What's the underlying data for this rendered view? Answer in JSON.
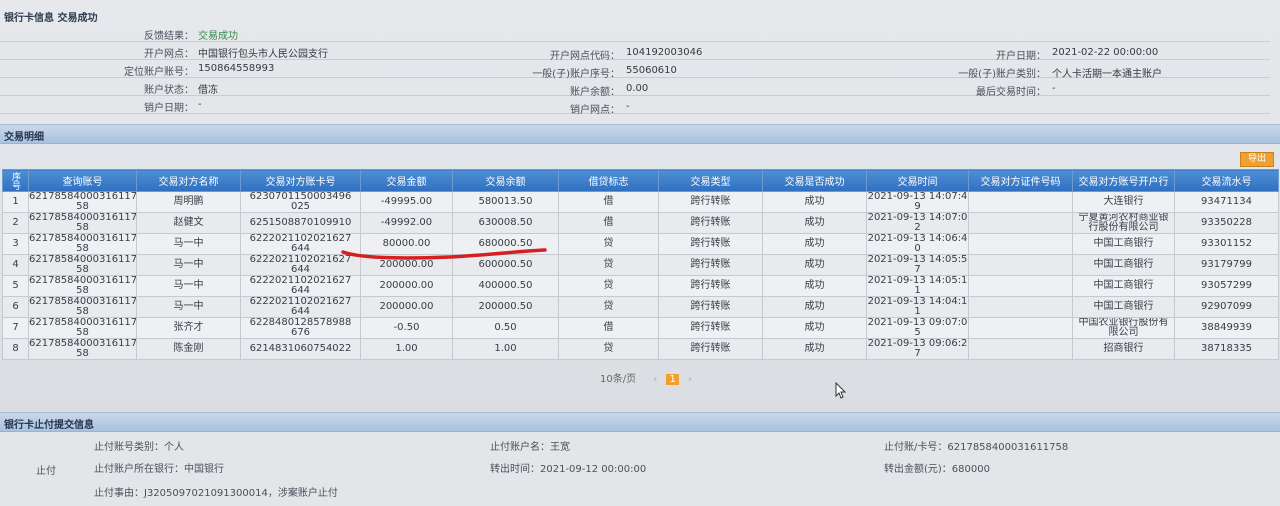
{
  "header": {
    "title": "银行卡信息 交易成功"
  },
  "info": {
    "feedback_label": "反馈结果：",
    "feedback_value": "交易成功",
    "branch_label": "开户网点：",
    "branch_value": "中国银行包头市人民公园支行",
    "branch_code_label": "开户网点代码：",
    "branch_code_value": "104192003046",
    "open_date_label": "开户日期：",
    "open_date_value": "2021-02-22 00:00:00",
    "account_label": "定位账户账号：",
    "account_value": "150864558993",
    "sub_serial_label": "一般(子)账户序号：",
    "sub_serial_value": "55060610",
    "sub_type_label": "一般(子)账户类别：",
    "sub_type_value": "个人卡活期一本通主账户",
    "status_label": "账户状态：",
    "status_value": "借冻",
    "balance_label": "账户余额：",
    "balance_value": "0.00",
    "last_trade_label": "最后交易时间：",
    "last_trade_value": "-",
    "close_date_label": "销户日期：",
    "close_date_value": "-",
    "close_branch_label": "销户网点：",
    "close_branch_value": "-"
  },
  "detail": {
    "title": "交易明细",
    "export_label": "导出",
    "columns": [
      "序号",
      "查询账号",
      "交易对方名称",
      "交易对方账卡号",
      "交易金额",
      "交易余额",
      "借贷标志",
      "交易类型",
      "交易是否成功",
      "交易时间",
      "交易对方证件号码",
      "交易对方账号开户行",
      "交易流水号"
    ],
    "rows": [
      [
        "1",
        "62178584000316117 58",
        "周明鹏",
        "6230701150003496 025",
        "-49995.00",
        "580013.50",
        "借",
        "跨行转账",
        "成功",
        "2021-09-13 14:07:4 9",
        "",
        "大连银行",
        "93471134"
      ],
      [
        "2",
        "62178584000316117 58",
        "赵健文",
        "6251508870109910",
        "-49992.00",
        "630008.50",
        "借",
        "跨行转账",
        "成功",
        "2021-09-13 14:07:0 2",
        "",
        "宁夏黄河农村商业银 行股份有限公司",
        "93350228"
      ],
      [
        "3",
        "62178584000316117 58",
        "马一中",
        "6222021102021627 644",
        "80000.00",
        "680000.50",
        "贷",
        "跨行转账",
        "成功",
        "2021-09-13 14:06:4 0",
        "",
        "中国工商银行",
        "93301152"
      ],
      [
        "4",
        "62178584000316117 58",
        "马一中",
        "6222021102021627 644",
        "200000.00",
        "600000.50",
        "贷",
        "跨行转账",
        "成功",
        "2021-09-13 14:05:5 7",
        "",
        "中国工商银行",
        "93179799"
      ],
      [
        "5",
        "62178584000316117 58",
        "马一中",
        "6222021102021627 644",
        "200000.00",
        "400000.50",
        "贷",
        "跨行转账",
        "成功",
        "2021-09-13 14:05:1 1",
        "",
        "中国工商银行",
        "93057299"
      ],
      [
        "6",
        "62178584000316117 58",
        "马一中",
        "6222021102021627 644",
        "200000.00",
        "200000.50",
        "贷",
        "跨行转账",
        "成功",
        "2021-09-13 14:04:1 1",
        "",
        "中国工商银行",
        "92907099"
      ],
      [
        "7",
        "62178584000316117 58",
        "张齐才",
        "6228480128578988 676",
        "-0.50",
        "0.50",
        "借",
        "跨行转账",
        "成功",
        "2021-09-13 09:07:0 5",
        "",
        "中国农业银行股份有 限公司",
        "38849939"
      ],
      [
        "8",
        "62178584000316117 58",
        "陈金刚",
        "6214831060754022",
        "1.00",
        "1.00",
        "贷",
        "跨行转账",
        "成功",
        "2021-09-13 09:06:2 7",
        "",
        "招商银行",
        "38718335"
      ]
    ],
    "pager_text": "10条/页",
    "pager_prev": "‹",
    "current_page": "1",
    "pager_next": "›"
  },
  "stop": {
    "title": "银行卡止付提交信息",
    "side_label": "止付",
    "type": "止付账号类别：个人",
    "name": "止付账户名：王宽",
    "card": "止付账/卡号：6217858400031611758",
    "bank": "止付账户所在银行：中国银行",
    "time": "转出时间：2021-09-12 00:00:00",
    "amount": "转出金额(元)：680000",
    "reason": "止付事由：J3205097021091300014，涉案账户止付"
  }
}
